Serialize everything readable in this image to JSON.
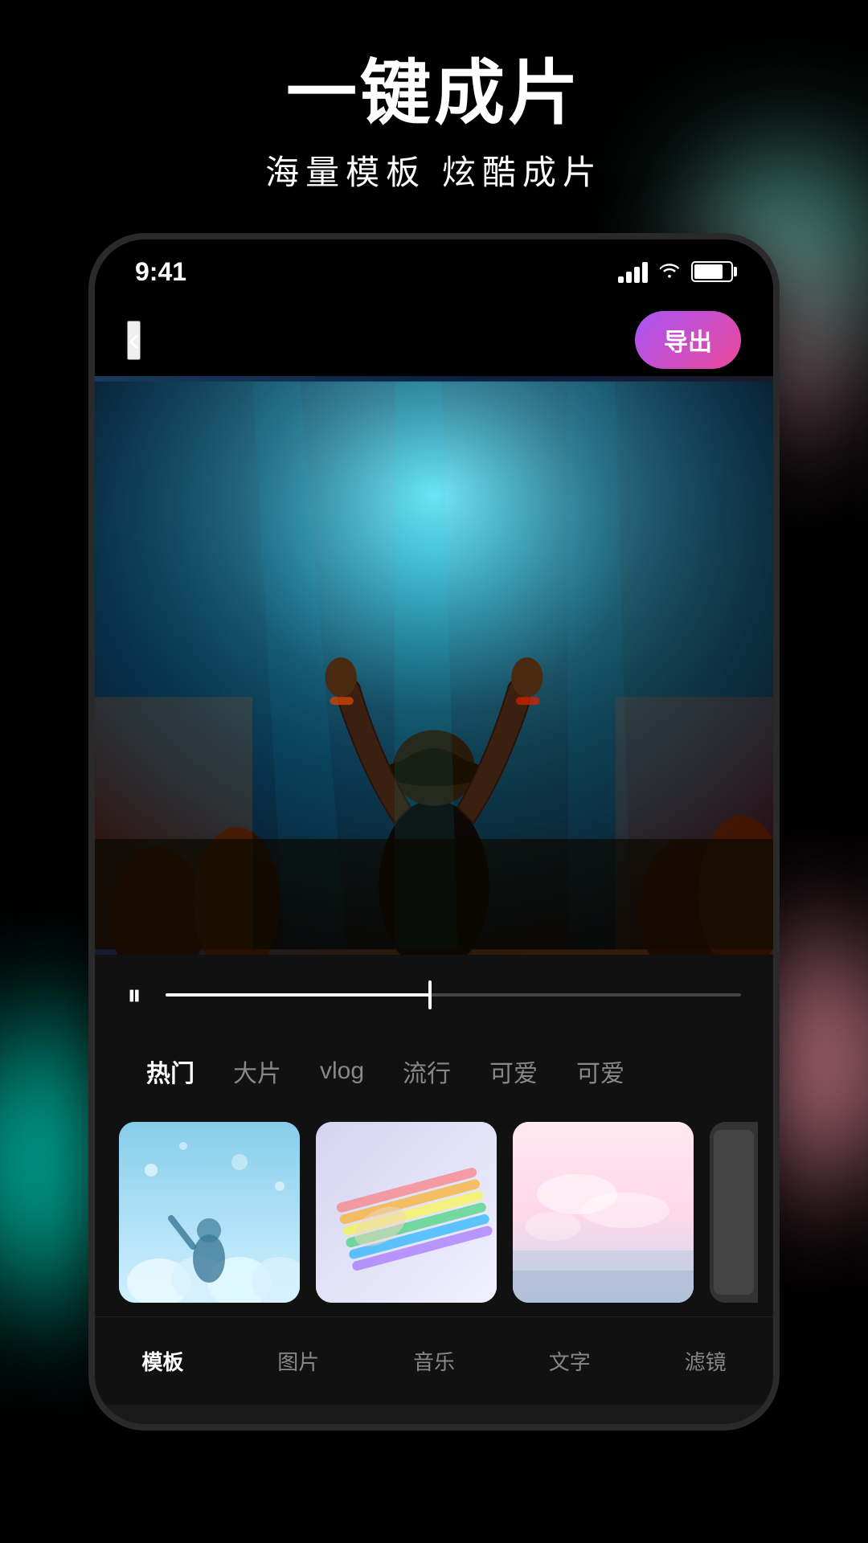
{
  "background": {
    "color": "#000000"
  },
  "top_section": {
    "main_title": "一键成片",
    "sub_title": "海量模板  炫酷成片"
  },
  "status_bar": {
    "time": "9:41",
    "signal_label": "signal",
    "wifi_label": "wifi",
    "battery_label": "battery"
  },
  "nav_bar": {
    "back_label": "‹",
    "export_label": "导出"
  },
  "playback": {
    "pause_icon": "⏸",
    "progress_percent": 46
  },
  "category_tabs": {
    "items": [
      {
        "label": "热门",
        "active": true
      },
      {
        "label": "大片",
        "active": false
      },
      {
        "label": "vlog",
        "active": false
      },
      {
        "label": "流行",
        "active": false
      },
      {
        "label": "可爱",
        "active": false
      },
      {
        "label": "可爱",
        "active": false
      }
    ]
  },
  "bottom_nav": {
    "items": [
      {
        "label": "模板",
        "active": true
      },
      {
        "label": "图片",
        "active": false
      },
      {
        "label": "音乐",
        "active": false
      },
      {
        "label": "文字",
        "active": false
      },
      {
        "label": "滤镜",
        "active": false
      }
    ]
  }
}
